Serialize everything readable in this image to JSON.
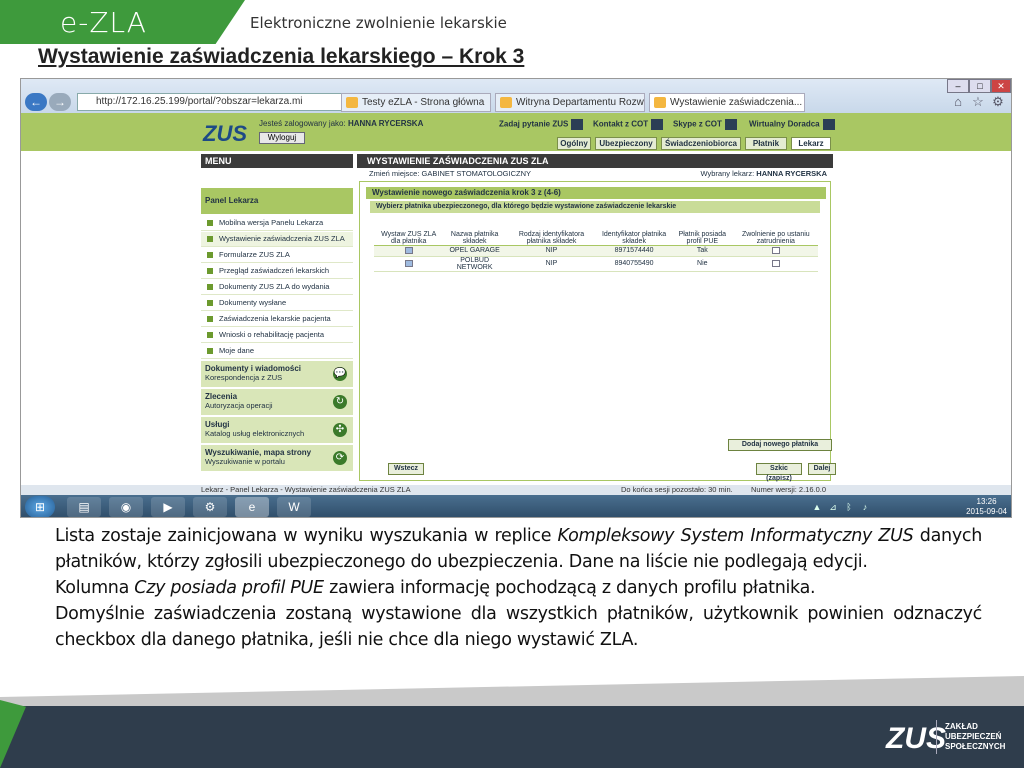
{
  "header": {
    "brand": "e-ZLA",
    "subtitle": "Elektroniczne zwolnienie lekarskie",
    "title": "Wystawienie zaświadczenia lekarskiego – Krok 3"
  },
  "browser": {
    "url": "http://172.16.25.199/portal/?obszar=lekarza.mi",
    "tabs": [
      "Testy eZLA - Strona główna",
      "Witryna Departamentu Rozwoj...",
      "Wystawienie zaświadczenia..."
    ]
  },
  "portal": {
    "logo": "ZUS",
    "logged_label": "Jesteś zalogowany jako:",
    "logged_user": "HANNA RYCERSKA",
    "logout": "Wyloguj",
    "top_actions": [
      "Zadaj pytanie ZUS",
      "Kontakt z COT",
      "Skype z COT",
      "Wirtualny Doradca"
    ],
    "role_tabs": [
      "Ogólny",
      "Ubezpieczony",
      "Świadczeniobiorca",
      "Płatnik",
      "Lekarz"
    ],
    "menu_title": "MENU",
    "panel_title": "Panel Lekarza",
    "menu_items": [
      "Mobilna wersja Panelu Lekarza",
      "Wystawienie zaświadczenia ZUS ZLA",
      "Formularze ZUS ZLA",
      "Przegląd zaświadczeń lekarskich",
      "Dokumenty ZUS ZLA do wydania",
      "Dokumenty wysłane",
      "Zaświadczenia lekarskie pacjenta",
      "Wnioski o rehabilitację pacjenta",
      "Moje dane"
    ],
    "sections": [
      {
        "title": "Dokumenty i wiadomości",
        "sub": "Korespondencja z ZUS"
      },
      {
        "title": "Zlecenia",
        "sub": "Autoryzacja operacji"
      },
      {
        "title": "Usługi",
        "sub": "Katalog usług elektronicznych"
      },
      {
        "title": "Wyszukiwanie, mapa strony",
        "sub": "Wyszukiwanie w portalu"
      }
    ],
    "main_title": "WYSTAWIENIE ZAŚWIADCZENIA ZUS ZLA",
    "place_label": "Zmień miejsce:",
    "place_value": "GABINET STOMATOLOGICZNY",
    "doctor_label": "Wybrany lekarz:",
    "doctor_value": "HANNA RYCERSKA",
    "step": "Wystawienie nowego zaświadczenia krok 3 z (4-6)",
    "info": "Wybierz płatnika ubezpieczonego, dla którego będzie wystawione zaświadczenie lekarskie",
    "table": {
      "headers": [
        "Wystaw ZUS ZLA dla płatnika",
        "Nazwa płatnika składek",
        "Rodzaj identyfikatora płatnika składek",
        "Identyfikator płatnika składek",
        "Płatnik posiada profil PUE",
        "Zwolnienie po ustaniu zatrudnienia"
      ],
      "rows": [
        [
          "",
          "OPEL GARAGE",
          "NIP",
          "8971574440",
          "Tak",
          ""
        ],
        [
          "",
          "POLBUD NETWORK",
          "NIP",
          "8940755490",
          "Nie",
          ""
        ]
      ]
    },
    "add_payer": "Dodaj nowego płatnika",
    "back": "Wstecz",
    "draft": "Szkic (zapisz)",
    "next": "Dalej"
  },
  "statusbar": {
    "left": "Lekarz - Panel Lekarza - Wystawienie zaświadczenia ZUS ZLA",
    "session": "Do końca sesji pozostało: 30 min.",
    "version": "Numer wersji: 2.16.0.0"
  },
  "taskbar": {
    "time": "13:26",
    "date": "2015-09-04"
  },
  "description": {
    "p1a": "Lista zostaje zainicjowana w wyniku wyszukania w replice ",
    "p1b": "Kompleksowy System Informatyczny ZUS",
    "p1c": " danych płatników, którzy zgłosili ubezpieczonego do ubezpieczenia. Dane na liście nie podlegają edycji.",
    "p2a": "Kolumna ",
    "p2b": "Czy posiada profil PUE",
    "p2c": " zawiera informację pochodzącą z danych profilu płatnika.",
    "p3": "Domyślnie zaświadczenia zostaną wystawione dla wszystkich płatników, użytkownik powinien odznaczyć checkbox dla danego płatnika, jeśli nie chce dla niego wystawić ZLA."
  },
  "footer": {
    "logo": "ZUS",
    "org_line1": "ZAKŁAD",
    "org_line2": "UBEZPIECZEŃ",
    "org_line3": "SPOŁECZNYCH"
  },
  "colors": {
    "brand_green": "#3e9a3c",
    "portal_green": "#a9c763",
    "footer_navy": "#2f3d4c"
  }
}
